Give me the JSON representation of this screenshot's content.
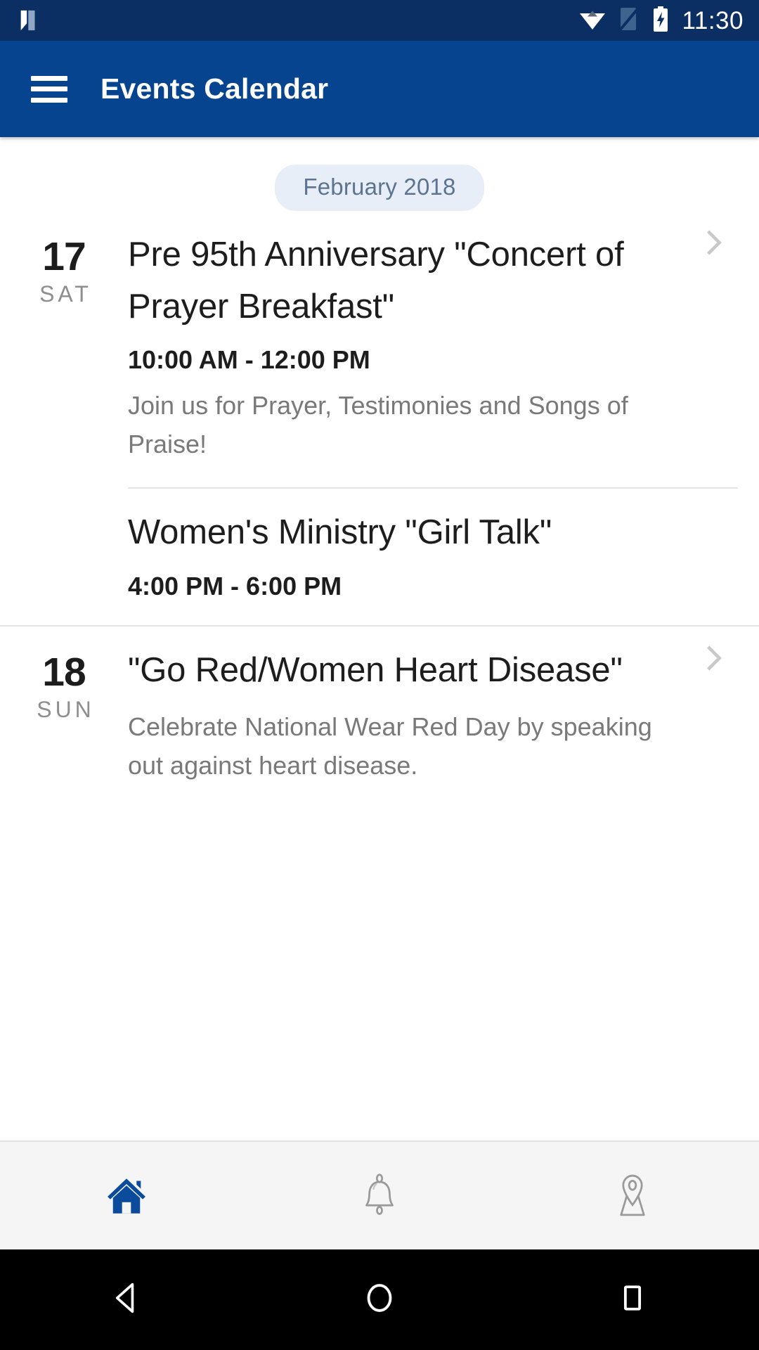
{
  "status_bar": {
    "app_logo": "n-logo-icon",
    "icons": [
      "wifi-icon",
      "signal-off-icon",
      "battery-charging-icon"
    ],
    "time": "11:30",
    "background_color": "#0c2f63"
  },
  "app_bar": {
    "menu_icon": "hamburger-menu-icon",
    "title": "Events Calendar",
    "background_color": "#064490"
  },
  "month_header": {
    "label": "February 2018",
    "background_color": "#e7eef8",
    "text_color": "#5c7490"
  },
  "day_groups": [
    {
      "date_number": "17",
      "day_of_week": "SAT",
      "events": [
        {
          "title": "Pre 95th Anniversary \"Concert of Prayer Breakfast\"",
          "time": "10:00 AM - 12:00 PM",
          "description": "Join us for Prayer, Testimonies and Songs of Praise!",
          "has_chevron": true
        },
        {
          "title": "Women's Ministry \"Girl Talk\"",
          "time": "4:00 PM - 6:00 PM",
          "description": "",
          "has_chevron": false
        }
      ]
    },
    {
      "date_number": "18",
      "day_of_week": "SUN",
      "events": [
        {
          "title": "\"Go Red/Women Heart Disease\"",
          "time": "",
          "description": "Celebrate National Wear Red Day by speaking out against heart disease.",
          "has_chevron": true
        }
      ]
    }
  ],
  "tab_bar": {
    "background_color": "#f5f5f5",
    "active_color": "#0b4b9c",
    "inactive_color": "#9a9a9a",
    "tabs": [
      {
        "name": "home",
        "icon": "home-icon",
        "active": true
      },
      {
        "name": "notifications",
        "icon": "bell-icon",
        "active": false
      },
      {
        "name": "locations",
        "icon": "map-pin-icon",
        "active": false
      }
    ]
  },
  "nav_bar": {
    "background_color": "#000000",
    "buttons": [
      {
        "name": "back",
        "icon": "back-triangle-icon"
      },
      {
        "name": "home",
        "icon": "home-circle-icon"
      },
      {
        "name": "recents",
        "icon": "recents-square-icon"
      }
    ]
  }
}
